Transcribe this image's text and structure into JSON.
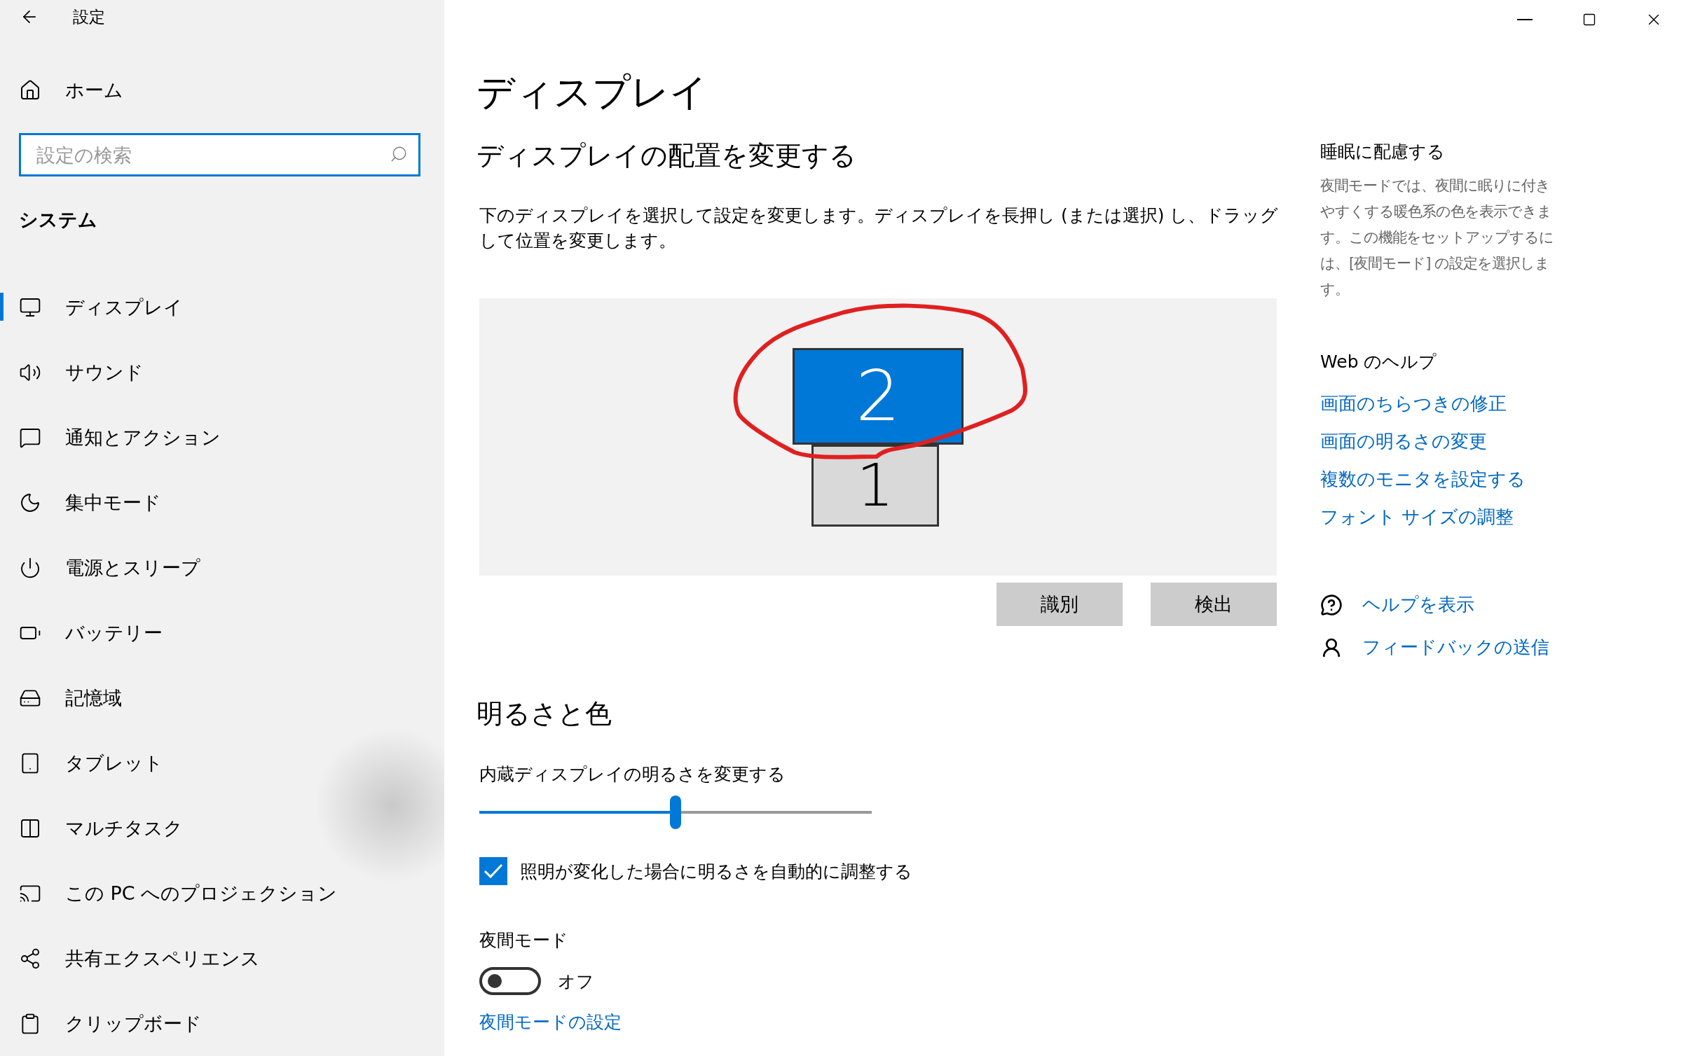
{
  "window": {
    "title": "設定"
  },
  "sidebar": {
    "home": "ホーム",
    "search": {
      "placeholder": "設定の検索"
    },
    "section": "システム",
    "items": [
      {
        "label": "ディスプレイ",
        "selected": true
      },
      {
        "label": "サウンド",
        "selected": false
      },
      {
        "label": "通知とアクション",
        "selected": false
      },
      {
        "label": "集中モード",
        "selected": false
      },
      {
        "label": "電源とスリープ",
        "selected": false
      },
      {
        "label": "バッテリー",
        "selected": false
      },
      {
        "label": "記憶域",
        "selected": false
      },
      {
        "label": "タブレット",
        "selected": false
      },
      {
        "label": "マルチタスク",
        "selected": false
      },
      {
        "label": "この PC へのプロジェクション",
        "selected": false
      },
      {
        "label": "共有エクスペリエンス",
        "selected": false
      },
      {
        "label": "クリップボード",
        "selected": false
      }
    ]
  },
  "page_title": "ディスプレイ",
  "arrangement": {
    "heading": "ディスプレイの配置を変更する",
    "description": "下のディスプレイを選択して設定を変更します。ディスプレイを長押し (または選択) し、ドラッグして位置を変更します。",
    "monitors": [
      {
        "label": "2",
        "selected": true
      },
      {
        "label": "1",
        "selected": false
      }
    ],
    "buttons": [
      "識別",
      "検出"
    ]
  },
  "brightness": {
    "heading": "明るさと色",
    "slider": {
      "label": "内蔵ディスプレイの明るさを変更する",
      "level": 0.5
    },
    "auto_adjust": {
      "label": "照明が変化した場合に明るさを自動的に調整する",
      "checked": true
    }
  },
  "night_light": {
    "label": "夜間モード",
    "on": false,
    "state_text": "オフ",
    "settings_link": "夜間モードの設定"
  },
  "sleep": {
    "heading": "睡眠に配慮する",
    "description": "夜間モードでは、夜間に眠りに付きやすくする暖色系の色を表示できます。この機能をセットアップするには、[夜間モード] の設定を選択します。"
  },
  "web_help": {
    "heading": "Web のヘルプ",
    "links": [
      "画面のちらつきの修正",
      "画面の明るさの変更",
      "複数のモニタを設定する",
      "フォント サイズの調整"
    ]
  },
  "support": [
    "ヘルプを表示",
    "フィードバックの送信"
  ]
}
